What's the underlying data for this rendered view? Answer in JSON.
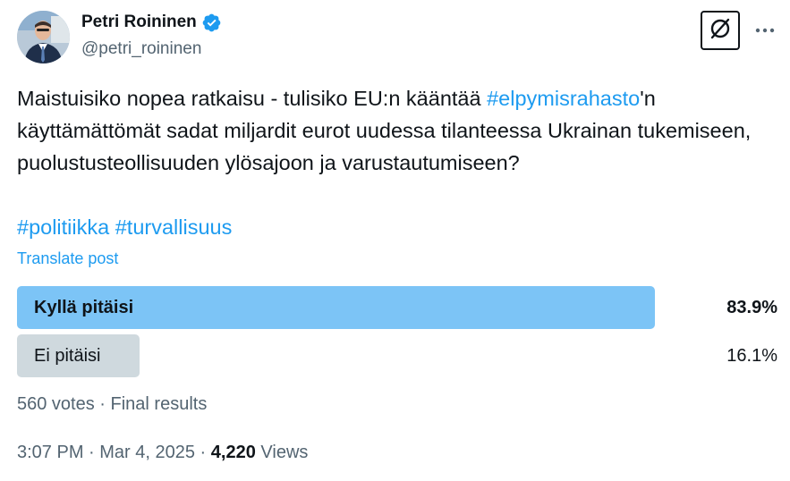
{
  "author": {
    "display_name": "Petri Roininen",
    "handle": "@petri_roininen",
    "verified": true
  },
  "actions": {
    "grok_icon": "grok-icon",
    "more_icon": "more-horizontal-icon"
  },
  "tweet": {
    "text_before": "Maistuisiko nopea ratkaisu - tulisiko EU:n kääntää ",
    "hashtag_inline": "#elpymisrahasto",
    "text_after": "'n käyttämättömät sadat miljardit eurot uudessa tilanteessa Ukrainan tukemiseen, puolustusteollisuuden ylösajoon  ja varustautumiseen?",
    "hashtags": [
      "#politiikka",
      "#turvallisuus"
    ],
    "translate_label": "Translate post"
  },
  "poll": {
    "options": [
      {
        "label": "Kyllä pitäisi",
        "percent_label": "83.9%",
        "percent": 83.9,
        "winner": true,
        "color": "#7cc4f6"
      },
      {
        "label": "Ei pitäisi",
        "percent_label": "16.1%",
        "percent": 16.1,
        "winner": false,
        "color": "#cfd9de"
      }
    ],
    "votes": "560 votes",
    "separator": " · ",
    "status": "Final results"
  },
  "meta": {
    "time": "3:07 PM",
    "sep1": " · ",
    "date": "Mar 4, 2025",
    "sep2": " · ",
    "views_count": "4,220",
    "views_label": " Views"
  },
  "colors": {
    "link": "#1d9bf0",
    "text": "#0f1419",
    "secondary": "#536471",
    "verified": "#1d9bf0"
  }
}
